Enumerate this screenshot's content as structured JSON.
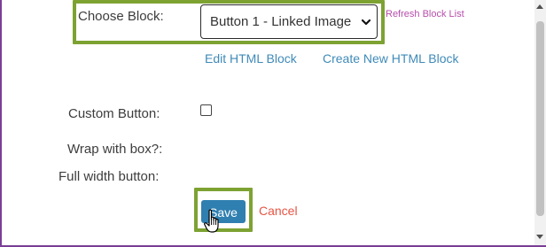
{
  "form": {
    "choose_block_label": "Choose Block:",
    "selected_block": "Button 1 - Linked Image",
    "refresh_link": "Refresh Block List",
    "edit_link": "Edit HTML Block",
    "create_link": "Create New HTML Block",
    "custom_button_label": "Custom Button:",
    "custom_button_checked": false,
    "wrap_label": "Wrap with box?:",
    "full_width_label": "Full width button:",
    "save_label": "Save",
    "cancel_label": "Cancel"
  },
  "icons": {
    "select": "chevron-down-icon",
    "cursor": "hand-pointer-icon"
  },
  "colors": {
    "highlight": "#7da232",
    "frame": "#7a3e96",
    "save_button": "#2f7fb0",
    "cancel": "#e55545",
    "link": "#3f8ab8",
    "refresh_link": "#b64eac"
  }
}
